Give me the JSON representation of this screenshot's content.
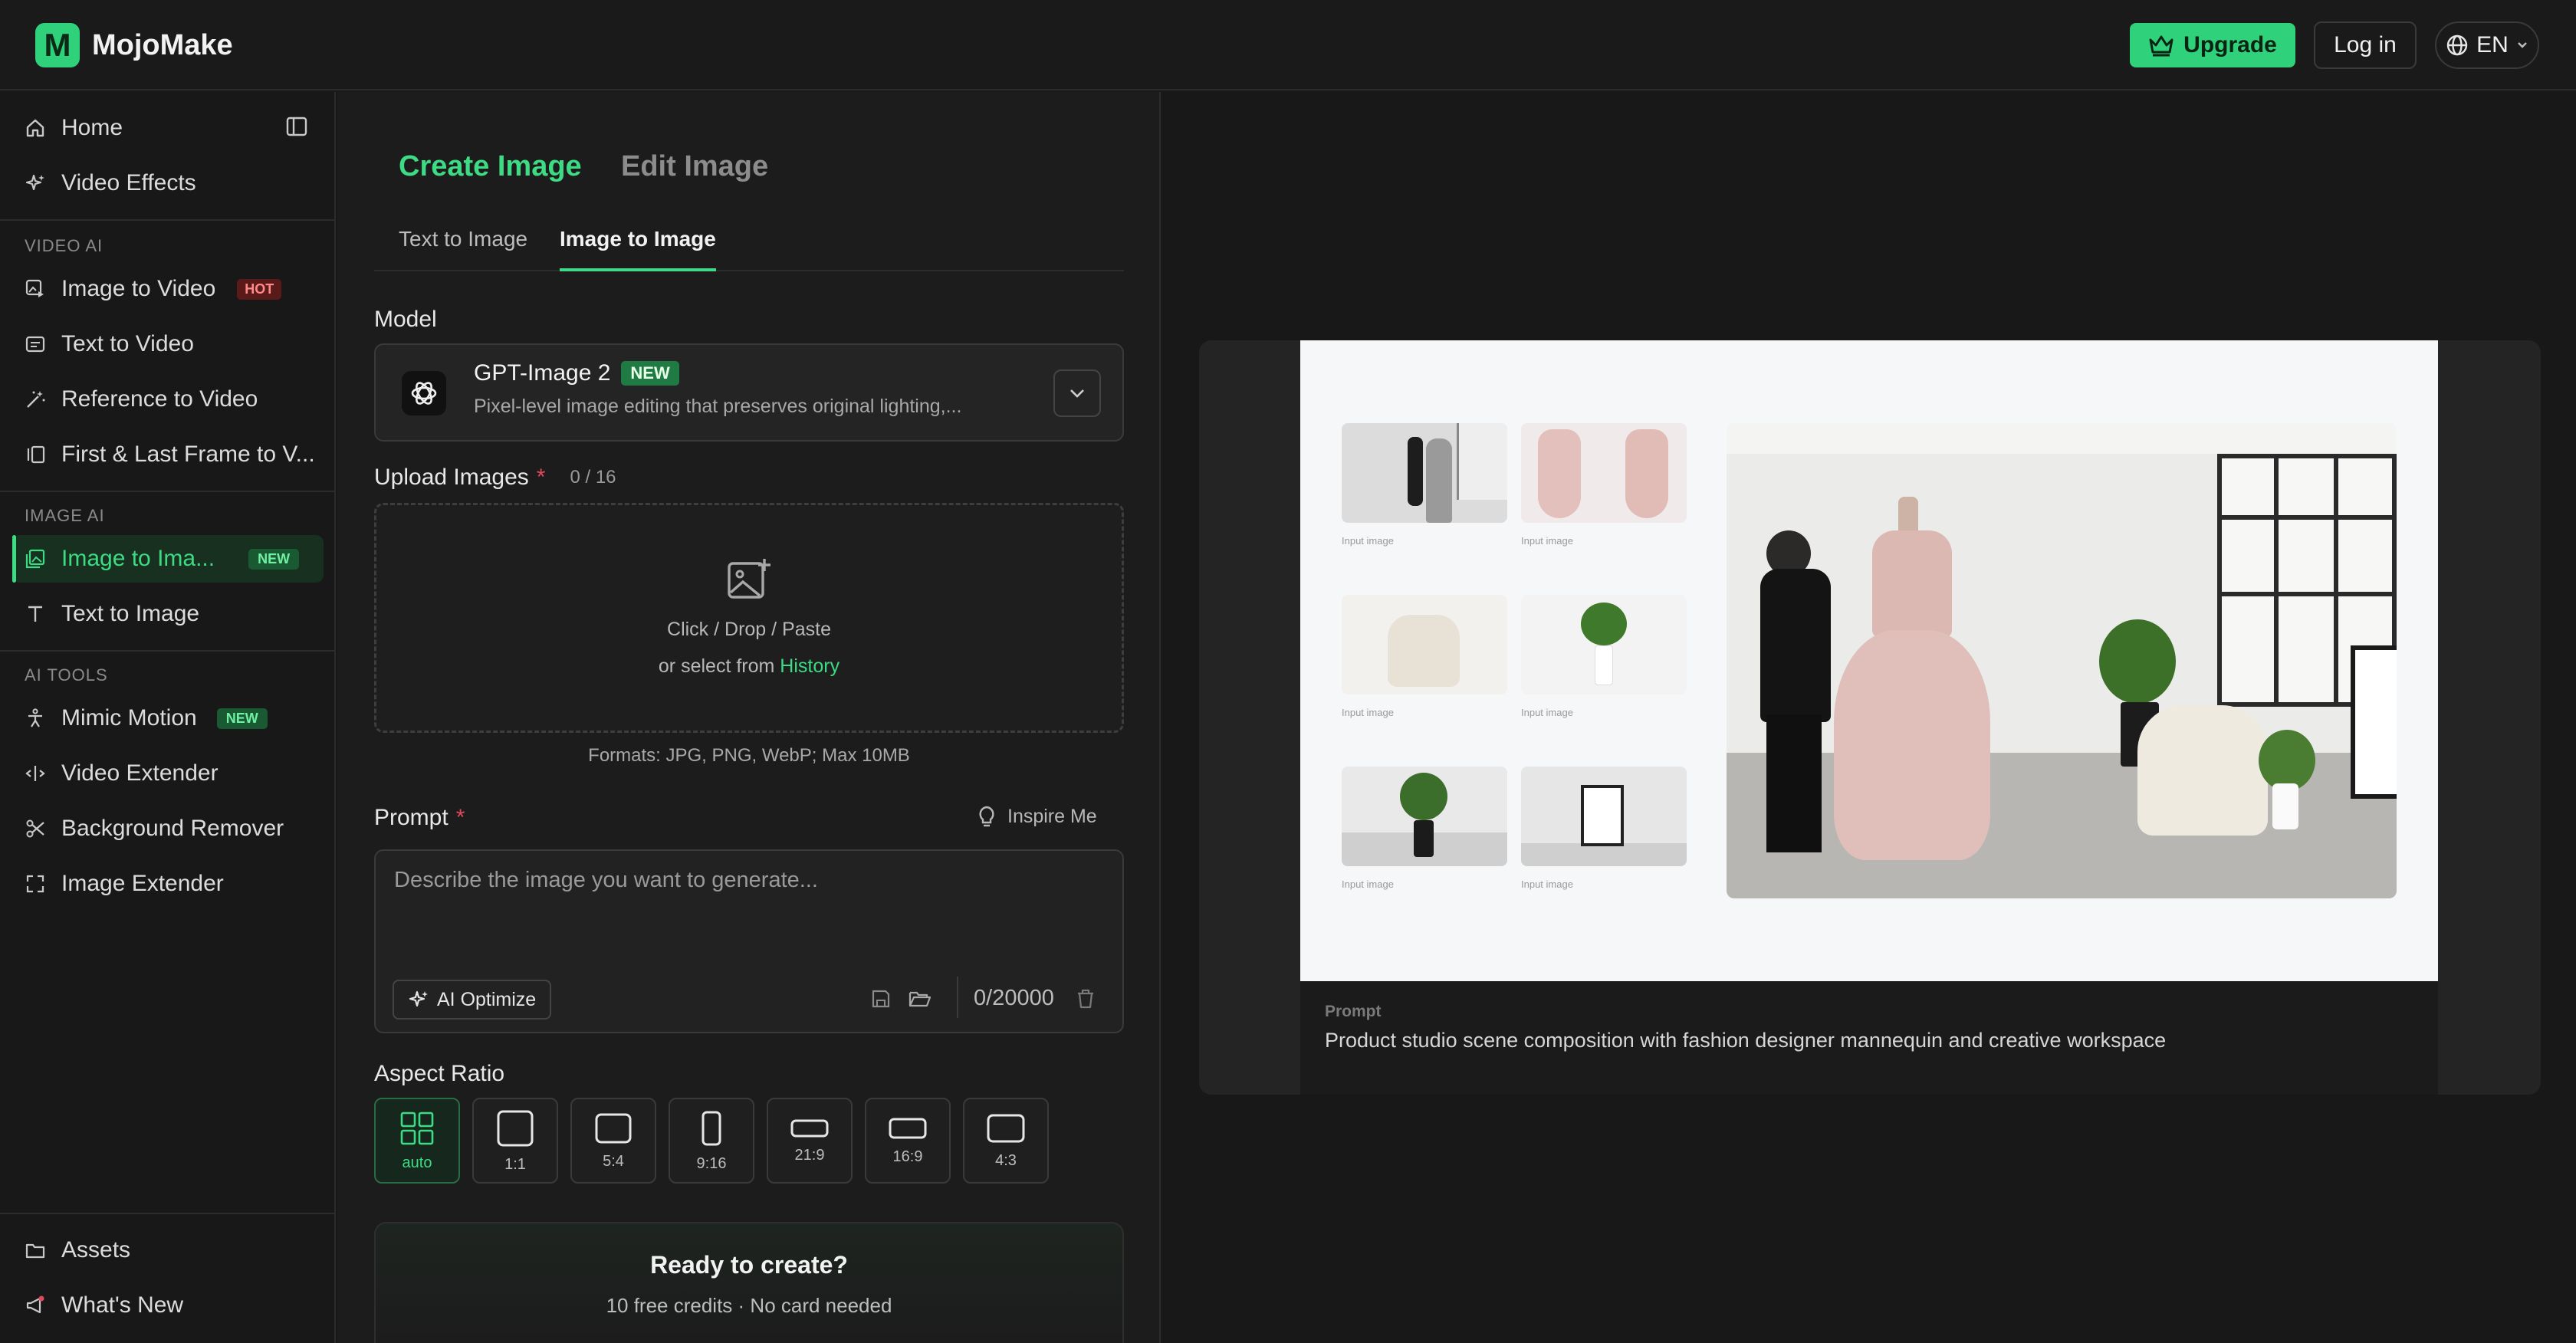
{
  "app": {
    "name": "MojoMake",
    "logo_letter": "M"
  },
  "topbar": {
    "upgrade_label": "Upgrade",
    "login_label": "Log in",
    "language": "EN"
  },
  "sidebar": {
    "top_items": [
      {
        "label": "Home",
        "icon": "home-icon"
      },
      {
        "label": "Video Effects",
        "icon": "sparkles-icon"
      }
    ],
    "sections": [
      {
        "title": "VIDEO AI",
        "items": [
          {
            "label": "Image to Video",
            "badge": "HOT"
          },
          {
            "label": "Text to Video"
          },
          {
            "label": "Reference to Video"
          },
          {
            "label": "First & Last Frame to V..."
          }
        ]
      },
      {
        "title": "IMAGE AI",
        "items": [
          {
            "label": "Image to Ima...",
            "badge": "NEW"
          },
          {
            "label": "Text to Image"
          }
        ]
      },
      {
        "title": "AI TOOLS",
        "items": [
          {
            "label": "Mimic Motion",
            "badge": "NEW"
          },
          {
            "label": "Video Extender"
          },
          {
            "label": "Background Remover"
          },
          {
            "label": "Image Extender"
          }
        ]
      }
    ],
    "bottom_items": [
      {
        "label": "Assets"
      },
      {
        "label": "What's New"
      }
    ]
  },
  "form": {
    "tabs": [
      "Create Image",
      "Edit Image"
    ],
    "subtabs": [
      "Text to Image",
      "Image to Image"
    ],
    "model_label": "Model",
    "model": {
      "name": "GPT-Image 2",
      "badge": "NEW",
      "description": "Pixel-level image editing that preserves original lighting,..."
    },
    "upload_label": "Upload Images",
    "upload_count": "0 / 16",
    "upload_line1": "Click / Drop / Paste",
    "upload_line2": "or select from",
    "upload_link": "History",
    "formats": "Formats: JPG, PNG, WebP; Max 10MB",
    "prompt_label": "Prompt",
    "inspire_label": "Inspire Me",
    "prompt_placeholder": "Describe the image you want to generate...",
    "ai_optimize_label": "AI Optimize",
    "char_count": "0/20000",
    "aspect_label": "Aspect Ratio",
    "aspect_ratios": [
      "auto",
      "1:1",
      "5:4",
      "9:16",
      "21:9",
      "16:9",
      "4:3"
    ],
    "cta_title": "Ready to create?",
    "cta_subtitle": "10 free credits · No card needed"
  },
  "preview": {
    "input_caption": "Input image",
    "caption_title": "Prompt",
    "caption_text": "Product studio scene composition with fashion designer mannequin and creative workspace"
  },
  "colors": {
    "accent": "#2fd17a",
    "background": "#181818",
    "panel": "#1c1c1c",
    "required": "#e0495a"
  }
}
